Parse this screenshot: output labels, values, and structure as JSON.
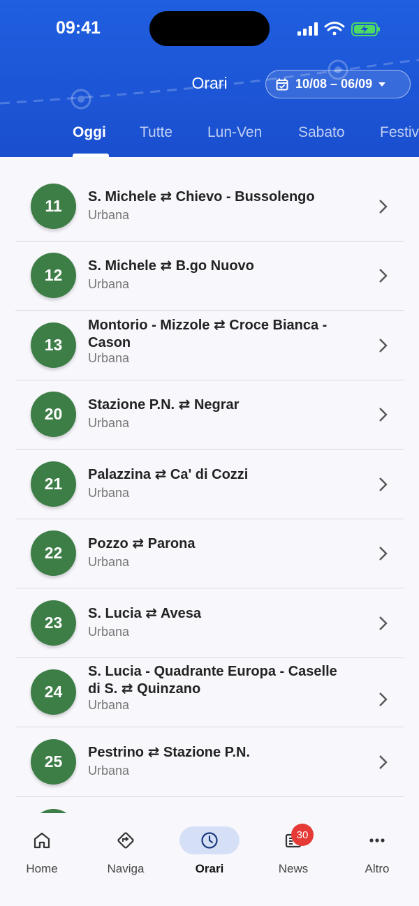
{
  "status_bar": {
    "time": "09:41"
  },
  "header": {
    "title": "Orari",
    "date_range": "10/08 – 06/09",
    "tabs": [
      "Oggi",
      "Tutte",
      "Lun-Ven",
      "Sabato",
      "Festivi"
    ],
    "active_tab": "Oggi"
  },
  "colors": {
    "header_blue": "#1f5fe0",
    "line_badge_green": "#3d7d46",
    "nav_active_pill": "#d5e0f7",
    "news_badge_red": "#e53a35"
  },
  "lines": [
    {
      "number": "11",
      "title_lines": [
        "S. Michele ⇄ Chievo - Bussolengo"
      ],
      "type": "Urbana"
    },
    {
      "number": "12",
      "title_lines": [
        "S. Michele ⇄ B.go Nuovo"
      ],
      "type": "Urbana"
    },
    {
      "number": "13",
      "title_lines": [
        "Montorio - Mizzole ⇄ Croce Bianca -",
        "Cason"
      ],
      "type": "Urbana"
    },
    {
      "number": "20",
      "title_lines": [
        "Stazione P.N. ⇄ Negrar"
      ],
      "type": "Urbana"
    },
    {
      "number": "21",
      "title_lines": [
        "Palazzina ⇄ Ca' di Cozzi"
      ],
      "type": "Urbana"
    },
    {
      "number": "22",
      "title_lines": [
        "Pozzo ⇄ Parona"
      ],
      "type": "Urbana"
    },
    {
      "number": "23",
      "title_lines": [
        "S. Lucia ⇄ Avesa"
      ],
      "type": "Urbana"
    },
    {
      "number": "24",
      "title_lines": [
        "S. Lucia - Quadrante Europa - Caselle",
        "di S. ⇄ Quinzano"
      ],
      "type": "Urbana"
    },
    {
      "number": "25",
      "title_lines": [
        "Pestrino ⇄ Stazione P.N."
      ],
      "type": "Urbana"
    }
  ],
  "bottom_nav": {
    "items": [
      {
        "label": "Home",
        "icon": "home-icon"
      },
      {
        "label": "Naviga",
        "icon": "directions-icon"
      },
      {
        "label": "Orari",
        "icon": "clock-icon",
        "active": true
      },
      {
        "label": "News",
        "icon": "newspaper-icon",
        "badge": "30"
      },
      {
        "label": "Altro",
        "icon": "more-icon"
      }
    ]
  }
}
